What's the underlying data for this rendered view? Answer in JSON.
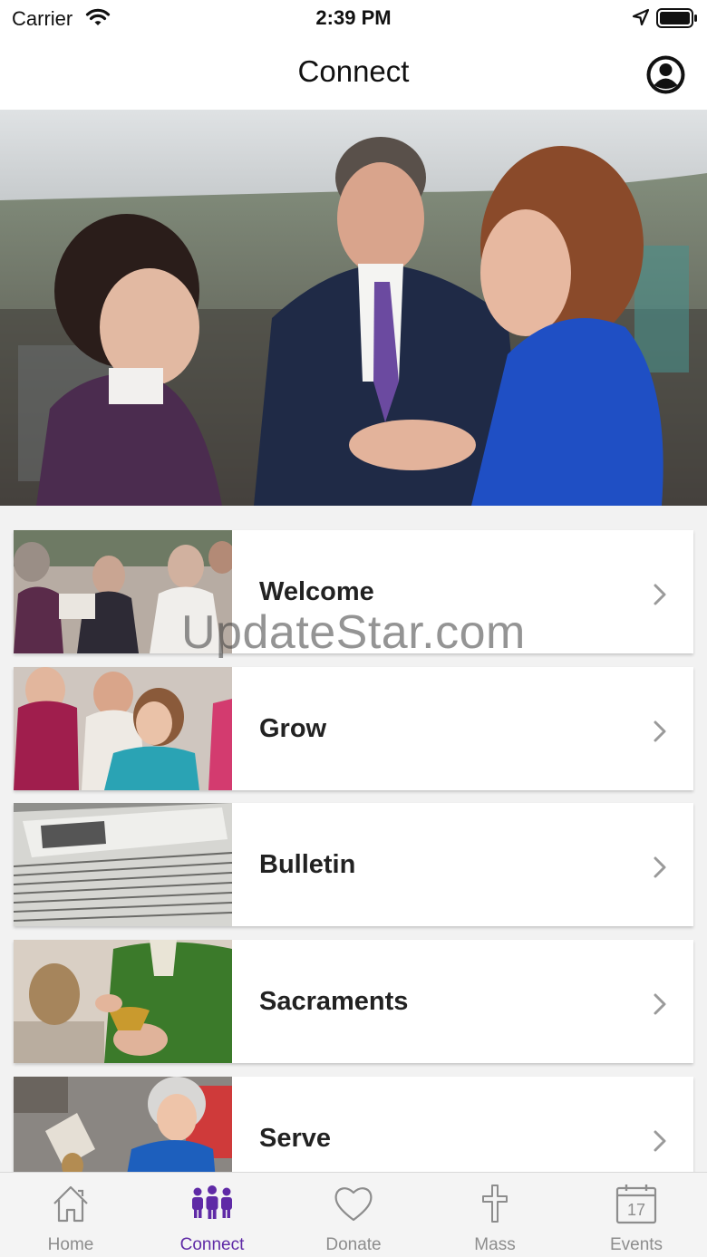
{
  "status_bar": {
    "carrier": "Carrier",
    "time": "2:39 PM"
  },
  "nav": {
    "title": "Connect",
    "profile_icon": "user-circle-icon"
  },
  "hero": {
    "image": "photo of three people conversing under a tent"
  },
  "menu": {
    "items": [
      {
        "label": "Welcome",
        "thumb": "choir-singing-photo"
      },
      {
        "label": "Grow",
        "thumb": "children-in-class-photo"
      },
      {
        "label": "Bulletin",
        "thumb": "newspaper-stack-photo"
      },
      {
        "label": "Sacraments",
        "thumb": "priest-with-chalice-photo"
      },
      {
        "label": "Serve",
        "thumb": "child-volunteer-photo"
      }
    ]
  },
  "watermark": "UpdateStar.com",
  "tabs": [
    {
      "label": "Home",
      "icon": "home-icon",
      "active": false
    },
    {
      "label": "Connect",
      "icon": "people-icon",
      "active": true
    },
    {
      "label": "Donate",
      "icon": "heart-icon",
      "active": false
    },
    {
      "label": "Mass",
      "icon": "cross-icon",
      "active": false
    },
    {
      "label": "Events",
      "icon": "calendar-icon",
      "active": false,
      "badge": "17"
    }
  ],
  "colors": {
    "accent": "#5f2aa6",
    "inactive_tab": "#8d8d8d",
    "card_bg": "#ffffff",
    "page_bg": "#f2f2f2"
  }
}
